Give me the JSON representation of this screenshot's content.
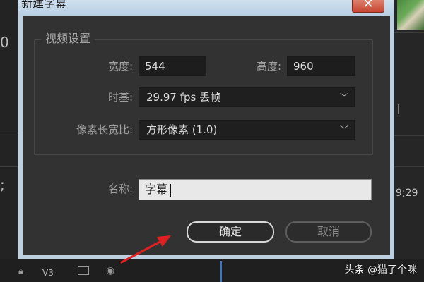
{
  "dialog": {
    "title": "新建字幕",
    "close_glyph": "✕"
  },
  "video_settings": {
    "legend": "视频设置",
    "width_label": "宽度:",
    "width_value": "544",
    "height_label": "高度:",
    "height_value": "960",
    "timebase_label": "时基:",
    "timebase_value": "29.97 fps 丢帧",
    "pixel_aspect_label": "像素长宽比:",
    "pixel_aspect_value": "方形像素 (1.0)"
  },
  "name": {
    "label": "名称:",
    "value": "字幕"
  },
  "buttons": {
    "ok": "确定",
    "cancel": "取消"
  },
  "background": {
    "left_glyphs": [
      "0",
      ";"
    ],
    "timecode": "9;29",
    "track_label": "V3"
  },
  "watermark": "头条 @猫了个咪",
  "colors": {
    "dialog_bg": "#323232",
    "frame": "#bcd0e2",
    "close_red": "#c74630",
    "arrow_red": "#e02020"
  }
}
